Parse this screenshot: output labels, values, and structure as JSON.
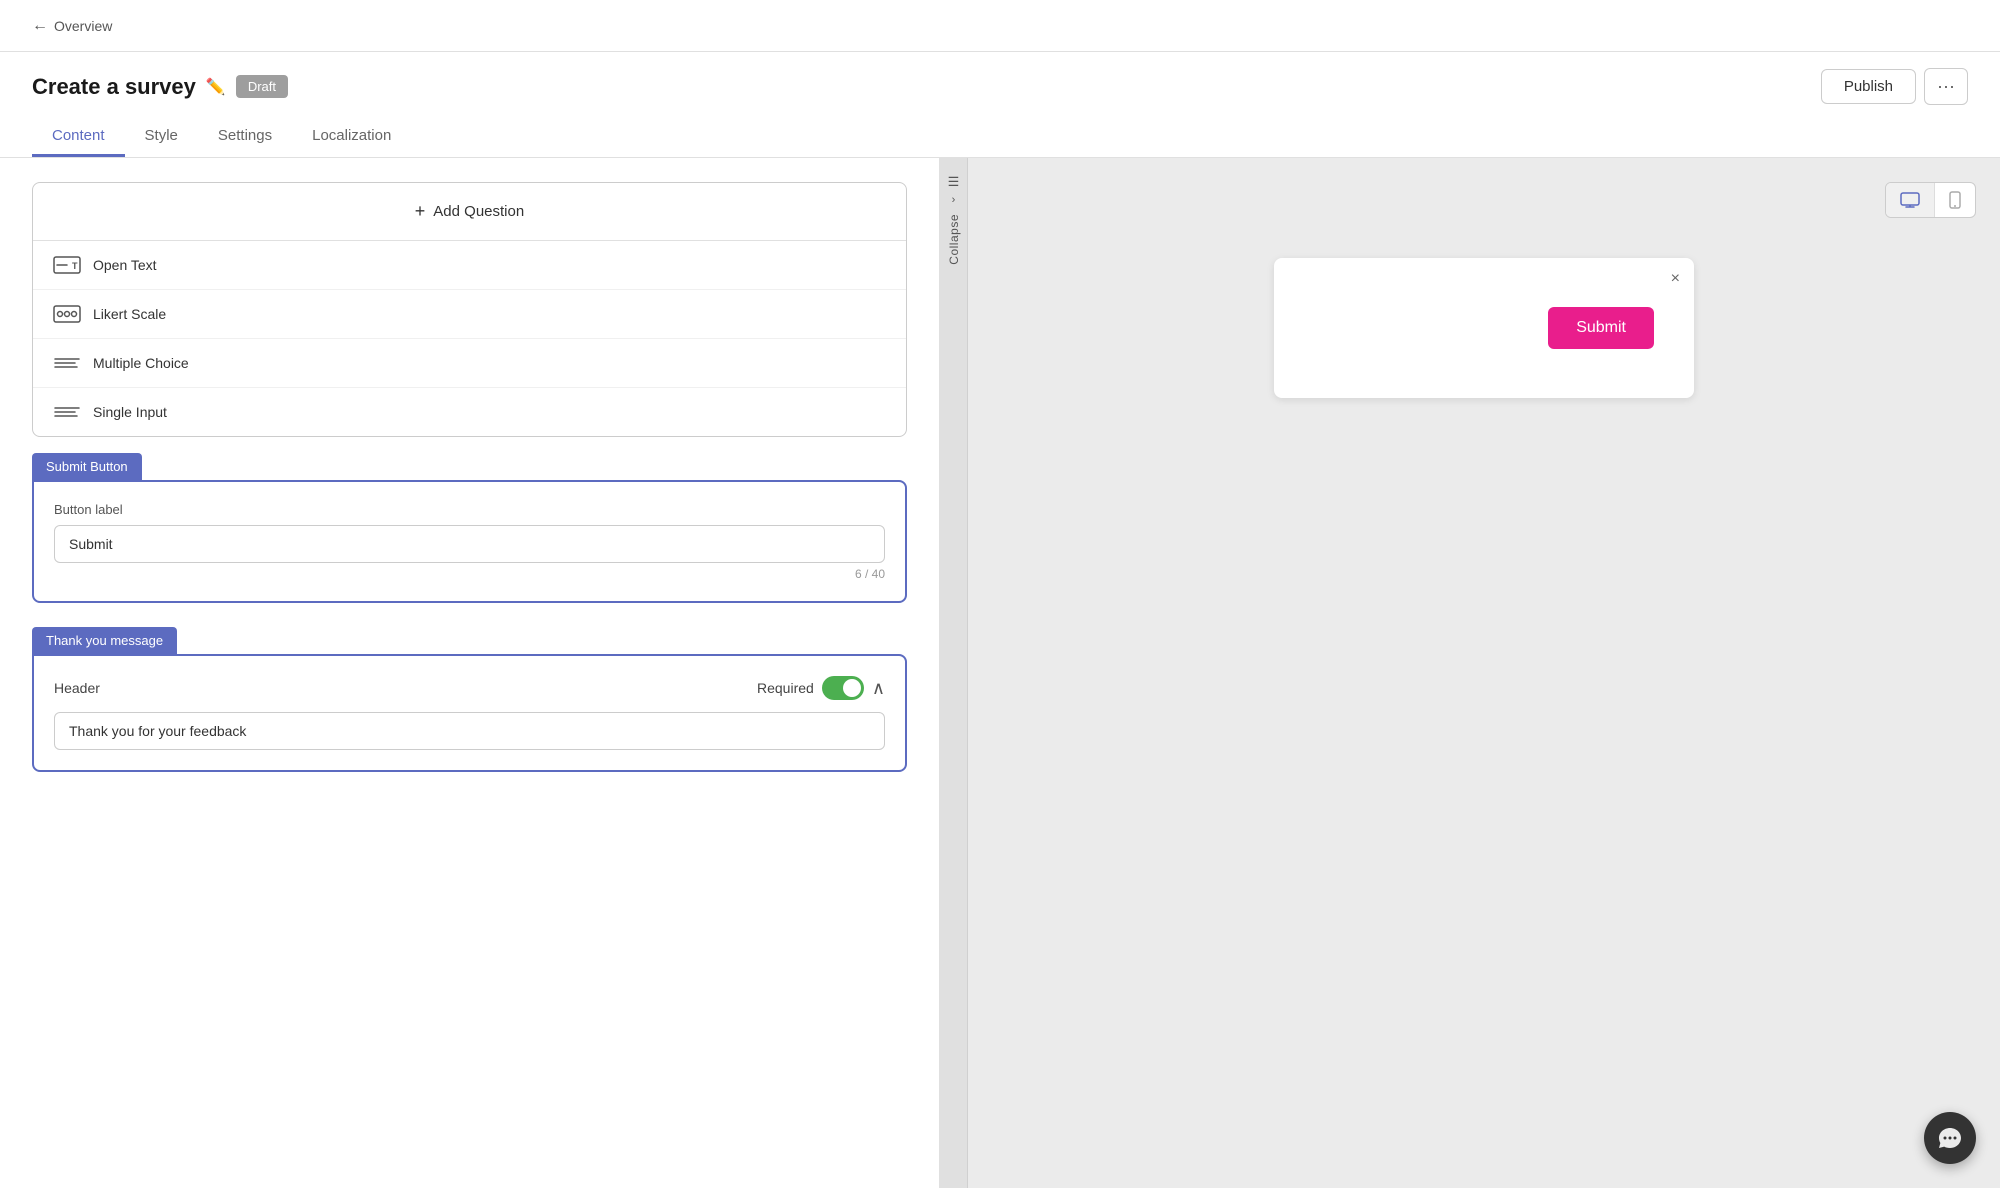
{
  "nav": {
    "back_label": "Overview"
  },
  "header": {
    "title": "Create a survey",
    "status": "Draft",
    "publish_label": "Publish",
    "more_label": "···"
  },
  "tabs": [
    {
      "id": "content",
      "label": "Content",
      "active": true
    },
    {
      "id": "style",
      "label": "Style",
      "active": false
    },
    {
      "id": "settings",
      "label": "Settings",
      "active": false
    },
    {
      "id": "localization",
      "label": "Localization",
      "active": false
    }
  ],
  "add_question": {
    "btn_label": "Add Question",
    "types": [
      {
        "id": "open-text",
        "label": "Open Text"
      },
      {
        "id": "likert-scale",
        "label": "Likert Scale"
      },
      {
        "id": "multiple-choice",
        "label": "Multiple Choice"
      },
      {
        "id": "single-input",
        "label": "Single Input"
      }
    ]
  },
  "submit_button_section": {
    "tab_label": "Submit Button",
    "button_label_field": "Button label",
    "button_label_value": "Submit",
    "char_count": "6 / 40"
  },
  "thank_you_section": {
    "tab_label": "Thank you message",
    "header_field": "Header",
    "header_value": "Thank you for your feedback",
    "required_label": "Required",
    "required_enabled": true
  },
  "collapse": {
    "label": "Collapse"
  },
  "preview": {
    "submit_btn_label": "Submit",
    "close_icon": "×"
  },
  "chat": {
    "icon": "💬"
  }
}
